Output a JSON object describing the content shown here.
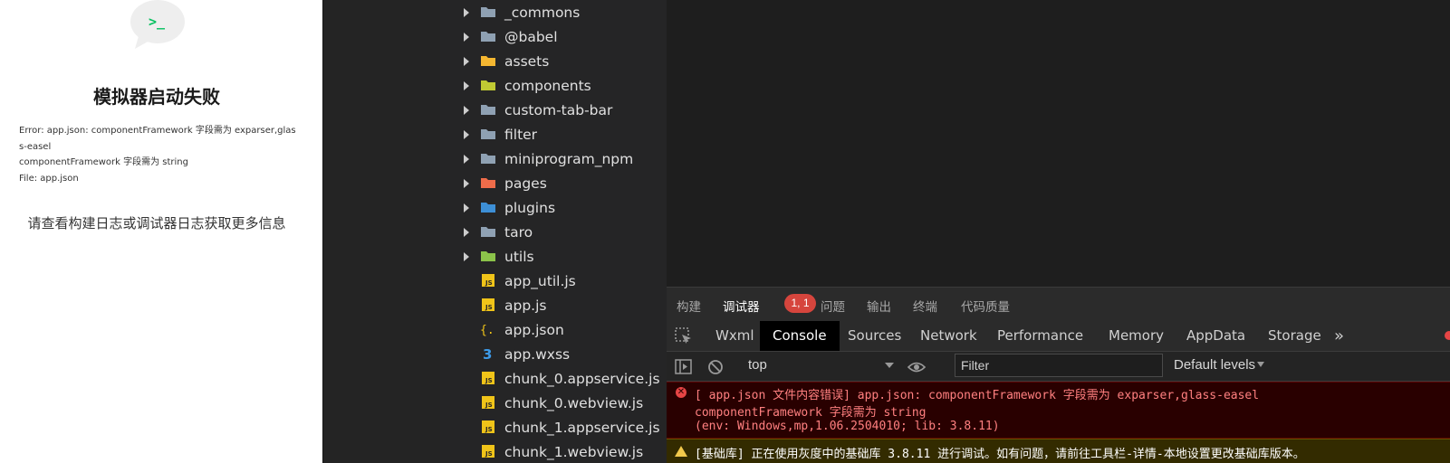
{
  "simulator": {
    "title": "模拟器启动失败",
    "error_lines": [
      "Error: app.json: componentFramework 字段需为 exparser,glass-easel",
      "componentFramework 字段需为 string",
      "File: app.json"
    ],
    "hint": "请查看构建日志或调试器日志获取更多信息",
    "logo_text": ">_"
  },
  "file_tree": {
    "items": [
      {
        "label": "_commons",
        "kind": "folder",
        "color": "#8fa1b3"
      },
      {
        "label": "@babel",
        "kind": "folder",
        "color": "#8fa1b3"
      },
      {
        "label": "assets",
        "kind": "folder",
        "color": "#f5b731"
      },
      {
        "label": "components",
        "kind": "folder",
        "color": "#c0ca33"
      },
      {
        "label": "custom-tab-bar",
        "kind": "folder",
        "color": "#8fa1b3"
      },
      {
        "label": "filter",
        "kind": "folder",
        "color": "#8fa1b3"
      },
      {
        "label": "miniprogram_npm",
        "kind": "folder",
        "color": "#8fa1b3"
      },
      {
        "label": "pages",
        "kind": "folder",
        "color": "#ef6c4a"
      },
      {
        "label": "plugins",
        "kind": "folder",
        "color": "#3d8fd6"
      },
      {
        "label": "taro",
        "kind": "folder",
        "color": "#8fa1b3"
      },
      {
        "label": "utils",
        "kind": "folder",
        "color": "#8bc34a"
      },
      {
        "label": "app_util.js",
        "kind": "js"
      },
      {
        "label": "app.js",
        "kind": "js"
      },
      {
        "label": "app.json",
        "kind": "json"
      },
      {
        "label": "app.wxss",
        "kind": "css"
      },
      {
        "label": "chunk_0.appservice.js",
        "kind": "js"
      },
      {
        "label": "chunk_0.webview.js",
        "kind": "js"
      },
      {
        "label": "chunk_1.appservice.js",
        "kind": "js"
      },
      {
        "label": "chunk_1.webview.js",
        "kind": "js"
      }
    ]
  },
  "panel_tabs": {
    "build": "构建",
    "debugger": "调试器",
    "badge": "1, 1",
    "issues": "问题",
    "output": "输出",
    "terminal": "终端",
    "code_quality": "代码质量"
  },
  "devtools_tabs": {
    "wxml": "Wxml",
    "console": "Console",
    "sources": "Sources",
    "network": "Network",
    "performance": "Performance",
    "memory": "Memory",
    "appdata": "AppData",
    "storage": "Storage",
    "more": "»"
  },
  "toolbar": {
    "context": "top",
    "filter_placeholder": "Filter",
    "levels": "Default levels"
  },
  "console": {
    "error_lines": [
      "[ app.json 文件内容错误] app.json: componentFramework 字段需为 exparser,glass-easel",
      "componentFramework 字段需为 string",
      "(env: Windows,mp,1.06.2504010; lib: 3.8.11)"
    ],
    "warn_line": "[基础库] 正在使用灰度中的基础库 3.8.11 进行调试。如有问题，请前往工具栏-详情-本地设置更改基础库版本。"
  },
  "colors": {
    "accent_green": "#07c160",
    "error_bg": "#290000",
    "error_text": "#ff8080",
    "warn_bg": "#332b00",
    "badge_red": "#d6453d"
  }
}
